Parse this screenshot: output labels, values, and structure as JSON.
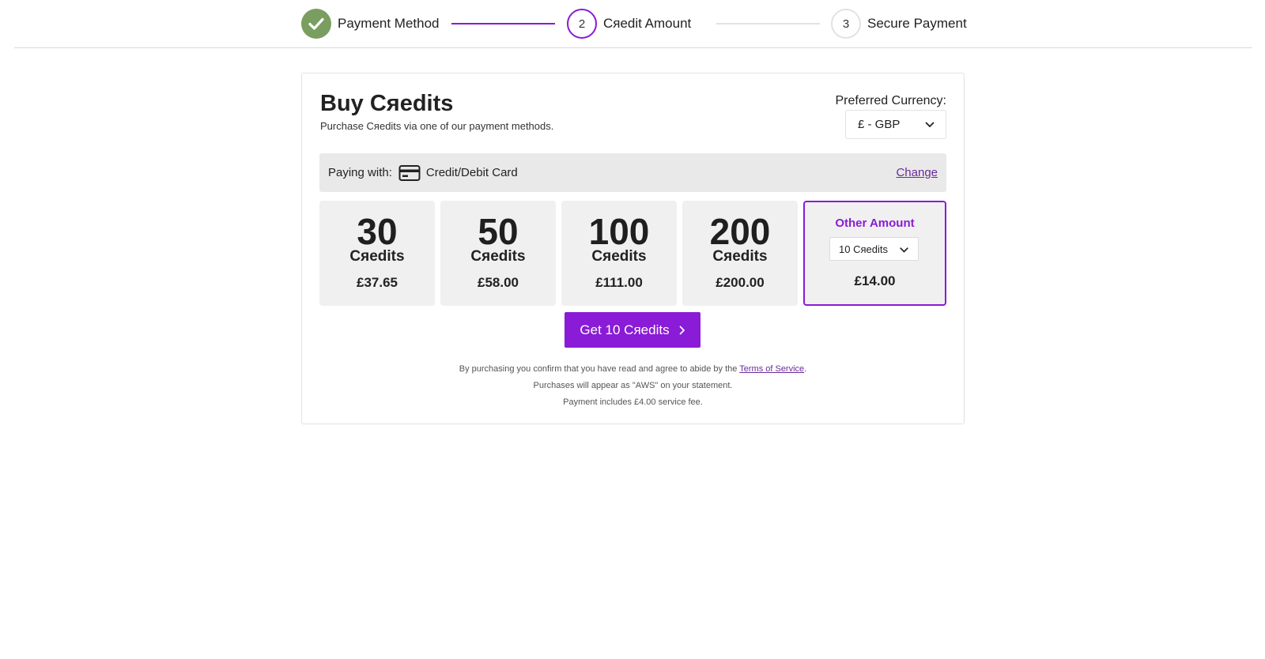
{
  "stepper": {
    "steps": [
      {
        "number": "",
        "label": "Payment Method",
        "state": "done"
      },
      {
        "number": "2",
        "label": "Cяedit Amount",
        "state": "active"
      },
      {
        "number": "3",
        "label": "Secure Payment",
        "state": "pending"
      }
    ]
  },
  "header": {
    "title": "Buy Cяedits",
    "subtitle": "Purchase Cяedits via one of our payment methods.",
    "currency_label": "Preferred Currency:",
    "currency_value": "£ - GBP"
  },
  "paying": {
    "label": "Paying with:",
    "method": "Credit/Debit Card",
    "change_label": "Change"
  },
  "packages": [
    {
      "amount": "30",
      "unit": "Cяedits",
      "price": "£37.65"
    },
    {
      "amount": "50",
      "unit": "Cяedits",
      "price": "£58.00"
    },
    {
      "amount": "100",
      "unit": "Cяedits",
      "price": "£111.00"
    },
    {
      "amount": "200",
      "unit": "Cяedits",
      "price": "£200.00"
    }
  ],
  "other": {
    "title": "Other Amount",
    "select_value": "10 Cяedits",
    "price": "£14.00",
    "selected": true
  },
  "cta": {
    "label": "Get 10 Cяedits"
  },
  "legal": {
    "line1_prefix": "By purchasing you confirm that you have read and agree to abide by the",
    "terms_link": "Terms of Service",
    "line1_suffix": ".",
    "line2": "Purchases will appear as \"AWS\" on your statement.",
    "line3": "Payment includes £4.00 service fee."
  },
  "colors": {
    "accent": "#8a1bd6",
    "done": "#7a9e5f",
    "link": "#6a2a9a",
    "tile_bg": "#f0f0f0",
    "paying_bg": "#e9e9e9"
  },
  "icons": {
    "step_done": "check-icon",
    "currency_dropdown": "chevron-down-icon",
    "payment_method": "credit-card-icon",
    "other_dropdown": "chevron-down-icon",
    "cta": "chevron-right-icon"
  }
}
